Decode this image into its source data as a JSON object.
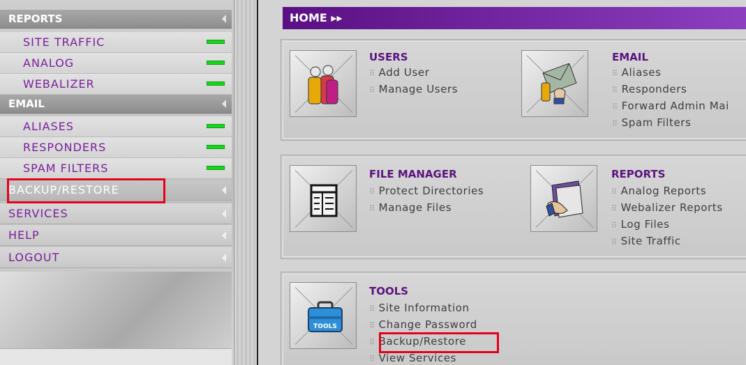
{
  "sidebar": {
    "reports_header": "REPORTS",
    "reports_items": [
      {
        "label": "SITE TRAFFIC"
      },
      {
        "label": "ANALOG"
      },
      {
        "label": "WEBALIZER"
      }
    ],
    "email_header": "EMAIL",
    "email_items": [
      {
        "label": "ALIASES"
      },
      {
        "label": "RESPONDERS"
      },
      {
        "label": "SPAM FILTERS"
      }
    ],
    "nav": [
      {
        "label": "BACKUP/RESTORE"
      },
      {
        "label": "SERVICES"
      },
      {
        "label": "HELP"
      },
      {
        "label": "LOGOUT"
      }
    ]
  },
  "main": {
    "breadcrumb": "HOME ▸▸",
    "groups": {
      "users": {
        "title": "USERS",
        "icon": "users-icon",
        "links": [
          "Add User",
          "Manage Users"
        ]
      },
      "email": {
        "title": "EMAIL",
        "icon": "email-icon",
        "links": [
          "Aliases",
          "Responders",
          "Forward Admin Mai",
          "Spam Filters"
        ]
      },
      "file_manager": {
        "title": "FILE MANAGER",
        "icon": "file-manager-icon",
        "links": [
          "Protect Directories",
          "Manage Files"
        ]
      },
      "reports": {
        "title": "REPORTS",
        "icon": "reports-icon",
        "links": [
          "Analog Reports",
          "Webalizer Reports",
          "Log Files",
          "Site Traffic"
        ]
      },
      "tools": {
        "title": "TOOLS",
        "icon": "toolbox-icon",
        "icon_label": "TOOLS",
        "links": [
          "Site Information",
          "Change Password",
          "Backup/Restore",
          "View Services"
        ]
      }
    }
  },
  "colors": {
    "accent": "#5a137e",
    "highlight": "#e3001a",
    "status_led": "#16d61c"
  }
}
